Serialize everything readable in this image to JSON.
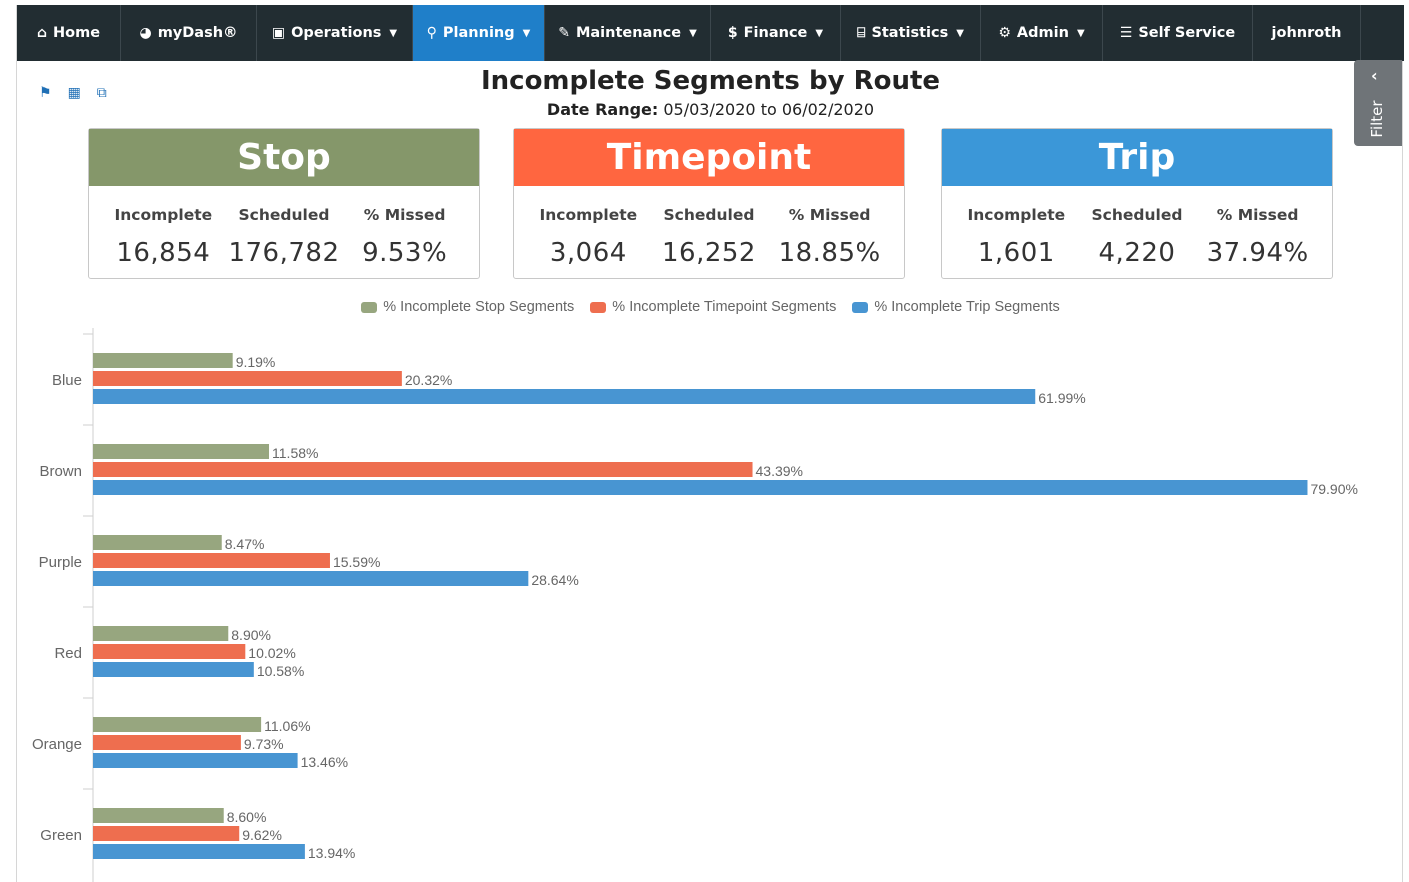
{
  "nav": {
    "items": [
      {
        "label": "Home",
        "icon": "home-icon",
        "glyph": "⌂",
        "caret": false,
        "active": false
      },
      {
        "label": "myDash®",
        "icon": "dashboard-icon",
        "glyph": "◕",
        "caret": false,
        "active": false
      },
      {
        "label": "Operations",
        "icon": "bus-icon",
        "glyph": "▣",
        "caret": true,
        "active": false
      },
      {
        "label": "Planning",
        "icon": "map-marker-icon",
        "glyph": "⚲",
        "caret": true,
        "active": true
      },
      {
        "label": "Maintenance",
        "icon": "wrench-icon",
        "glyph": "✎",
        "caret": true,
        "active": false
      },
      {
        "label": "Finance",
        "icon": "dollar-icon",
        "glyph": "$",
        "caret": true,
        "active": false
      },
      {
        "label": "Statistics",
        "icon": "bank-icon",
        "glyph": "⌸",
        "caret": true,
        "active": false
      },
      {
        "label": "Admin",
        "icon": "cogs-icon",
        "glyph": "⚙",
        "caret": true,
        "active": false
      },
      {
        "label": "Self Service",
        "icon": "database-icon",
        "glyph": "☰",
        "caret": false,
        "active": false
      },
      {
        "label": "johnroth",
        "icon": "",
        "glyph": "",
        "caret": false,
        "active": false
      }
    ]
  },
  "filter_label": "Filter",
  "page": {
    "title": "Incomplete Segments by Route",
    "date_range_label": "Date Range:",
    "date_from": "05/03/2020",
    "date_to_word": "to",
    "date_to": "06/02/2020"
  },
  "cards": [
    {
      "title": "Stop",
      "color": "#85976a",
      "incomplete": "16,854",
      "scheduled": "176,782",
      "missed": "9.53%"
    },
    {
      "title": "Timepoint",
      "color": "#ff6640",
      "incomplete": "3,064",
      "scheduled": "16,252",
      "missed": "18.85%"
    },
    {
      "title": "Trip",
      "color": "#3b97d8",
      "incomplete": "1,601",
      "scheduled": "4,220",
      "missed": "37.94%"
    }
  ],
  "card_labels": {
    "incomplete": "Incomplete",
    "scheduled": "Scheduled",
    "missed": "% Missed"
  },
  "chart_data": {
    "type": "bar",
    "orientation": "horizontal",
    "categories": [
      "Blue",
      "Brown",
      "Purple",
      "Red",
      "Orange",
      "Green"
    ],
    "series": [
      {
        "name": "% Incomplete Stop Segments",
        "color": "#97a67f",
        "values": [
          9.19,
          11.58,
          8.47,
          8.9,
          11.06,
          8.6
        ]
      },
      {
        "name": "% Incomplete Timepoint Segments",
        "color": "#ee6e4f",
        "values": [
          20.32,
          43.39,
          15.59,
          10.02,
          9.73,
          9.62
        ]
      },
      {
        "name": "% Incomplete Trip Segments",
        "color": "#4895d2",
        "values": [
          61.99,
          79.9,
          28.64,
          10.58,
          13.46,
          13.94
        ]
      }
    ],
    "labels": [
      [
        "9.19%",
        "20.32%",
        "61.99%"
      ],
      [
        "11.58%",
        "43.39%",
        "79.90%"
      ],
      [
        "8.47%",
        "15.59%",
        "28.64%"
      ],
      [
        "8.90%",
        "10.02%",
        "10.58%"
      ],
      [
        "11.06%",
        "9.73%",
        "13.46%"
      ],
      [
        "8.60%",
        "9.62%",
        "13.94%"
      ]
    ],
    "xlim": [
      0,
      100
    ],
    "legend_position": "top-center",
    "grid": false
  }
}
